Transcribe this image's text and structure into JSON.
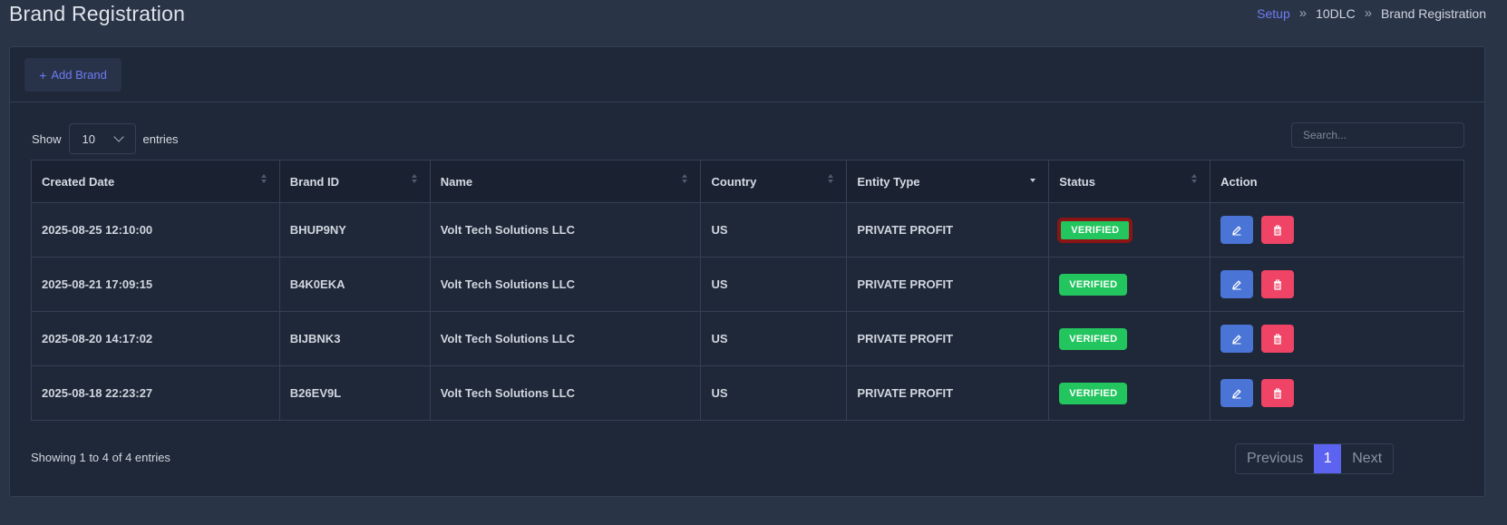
{
  "header": {
    "title": "Brand Registration",
    "breadcrumb": [
      "Setup",
      "10DLC",
      "Brand Registration"
    ],
    "breadcrumb_sep": "»"
  },
  "toolbar": {
    "add_brand_icon": "+",
    "add_brand_label": "Add Brand"
  },
  "table_controls": {
    "show_label": "Show",
    "page_length": "10",
    "entries_label": "entries",
    "search_placeholder": "Search..."
  },
  "table": {
    "columns": [
      "Created Date",
      "Brand ID",
      "Name",
      "Country",
      "Entity Type",
      "Status",
      "Action"
    ],
    "sorted_column": "Entity Type",
    "rows": [
      {
        "created": "2025-08-25 12:10:00",
        "brand_id": "BHUP9NY",
        "name": "Volt Tech Solutions LLC",
        "country": "US",
        "entity_type": "PRIVATE PROFIT",
        "status": "VERIFIED"
      },
      {
        "created": "2025-08-21 17:09:15",
        "brand_id": "B4K0EKA",
        "name": "Volt Tech Solutions LLC",
        "country": "US",
        "entity_type": "PRIVATE PROFIT",
        "status": "VERIFIED"
      },
      {
        "created": "2025-08-20 14:17:02",
        "brand_id": "BIJBNK3",
        "name": "Volt Tech Solutions LLC",
        "country": "US",
        "entity_type": "PRIVATE PROFIT",
        "status": "VERIFIED"
      },
      {
        "created": "2025-08-18 22:23:27",
        "brand_id": "B26EV9L",
        "name": "Volt Tech Solutions LLC",
        "country": "US",
        "entity_type": "PRIVATE PROFIT",
        "status": "VERIFIED"
      }
    ],
    "action_icons": [
      "pencil-icon",
      "trash-icon"
    ]
  },
  "footer": {
    "info": "Showing 1 to 4 of 4 entries",
    "previous_label": "Previous",
    "current_page": "1",
    "next_label": "Next"
  },
  "colors": {
    "background": "#2a3447",
    "card": "#1f2838",
    "accent": "#5b63f0",
    "status_verified": "#22c55e",
    "edit_button": "#4a74d6",
    "delete_button": "#ef4465",
    "highlight_outline": "#8b1414"
  }
}
